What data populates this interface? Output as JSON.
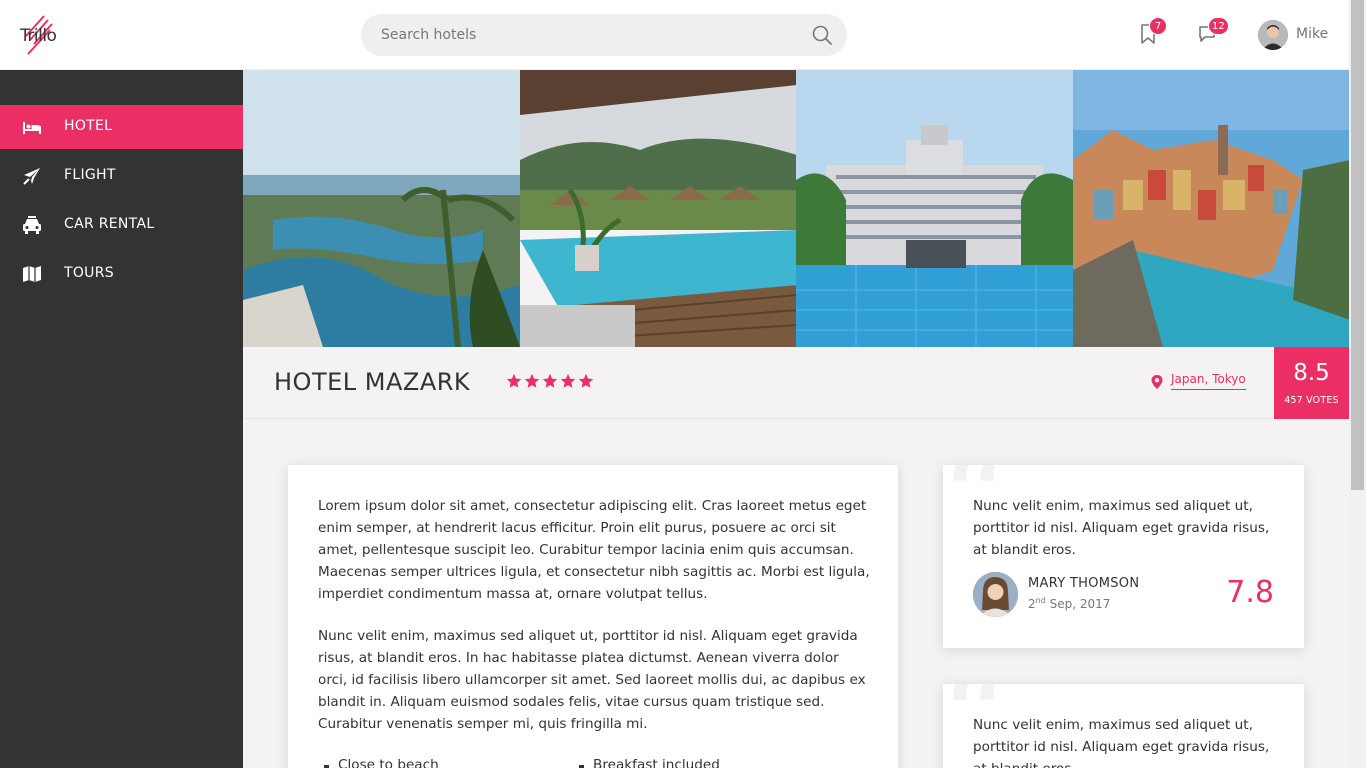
{
  "header": {
    "logo_text": "Trillo",
    "search_placeholder": "Search hotels",
    "bookmarks_count": "7",
    "messages_count": "12",
    "user_name": "Mike"
  },
  "sidebar": {
    "items": [
      {
        "label": "HOTEL",
        "icon": "bed-icon",
        "active": true
      },
      {
        "label": "FLIGHT",
        "icon": "airplane-icon",
        "active": false
      },
      {
        "label": "CAR RENTAL",
        "icon": "car-icon",
        "active": false
      },
      {
        "label": "TOURS",
        "icon": "map-icon",
        "active": false
      }
    ]
  },
  "overview": {
    "hotel_name": "HOTEL MAZARK",
    "stars": 5,
    "location": "Japan, Tokyo",
    "rating_average": "8.5",
    "rating_count": "457 VOTES"
  },
  "description": {
    "paragraphs": [
      "Lorem ipsum dolor sit amet, consectetur adipiscing elit. Cras laoreet metus eget enim semper, at hendrerit lacus efficitur. Proin elit purus, posuere ac orci sit amet, pellentesque suscipit leo. Curabitur tempor lacinia enim quis accumsan. Maecenas semper ultrices ligula, et consectetur nibh sagittis ac. Morbi est ligula, imperdiet condimentum massa at, ornare volutpat tellus.",
      "Nunc velit enim, maximus sed aliquet ut, porttitor id nisl. Aliquam eget gravida risus, at blandit eros. In hac habitasse platea dictumst. Aenean viverra dolor orci, id facilisis libero ullamcorper sit amet. Sed laoreet mollis dui, ac dapibus ex blandit in. Aliquam euismod sodales felis, vitae cursus quam tristique sed. Curabitur venenatis semper mi, quis fringilla mi."
    ],
    "features": [
      "Close to beach",
      "Breakfast included"
    ]
  },
  "reviews": [
    {
      "text": "Nunc velit enim, maximus sed aliquet ut, porttitor id nisl. Aliquam eget gravida risus, at blandit eros.",
      "name": "MARY THOMSON",
      "date_day": "2",
      "date_suffix": "nd",
      "date_rest": " Sep, 2017",
      "rating": "7.8"
    },
    {
      "text": "Nunc velit enim, maximus sed aliquet ut, porttitor id nisl. Aliquam eget gravida risus, at blandit eros."
    }
  ],
  "colors": {
    "primary": "#eb2f64",
    "sidebar_bg": "#333333",
    "page_bg": "#f4f2f2"
  }
}
